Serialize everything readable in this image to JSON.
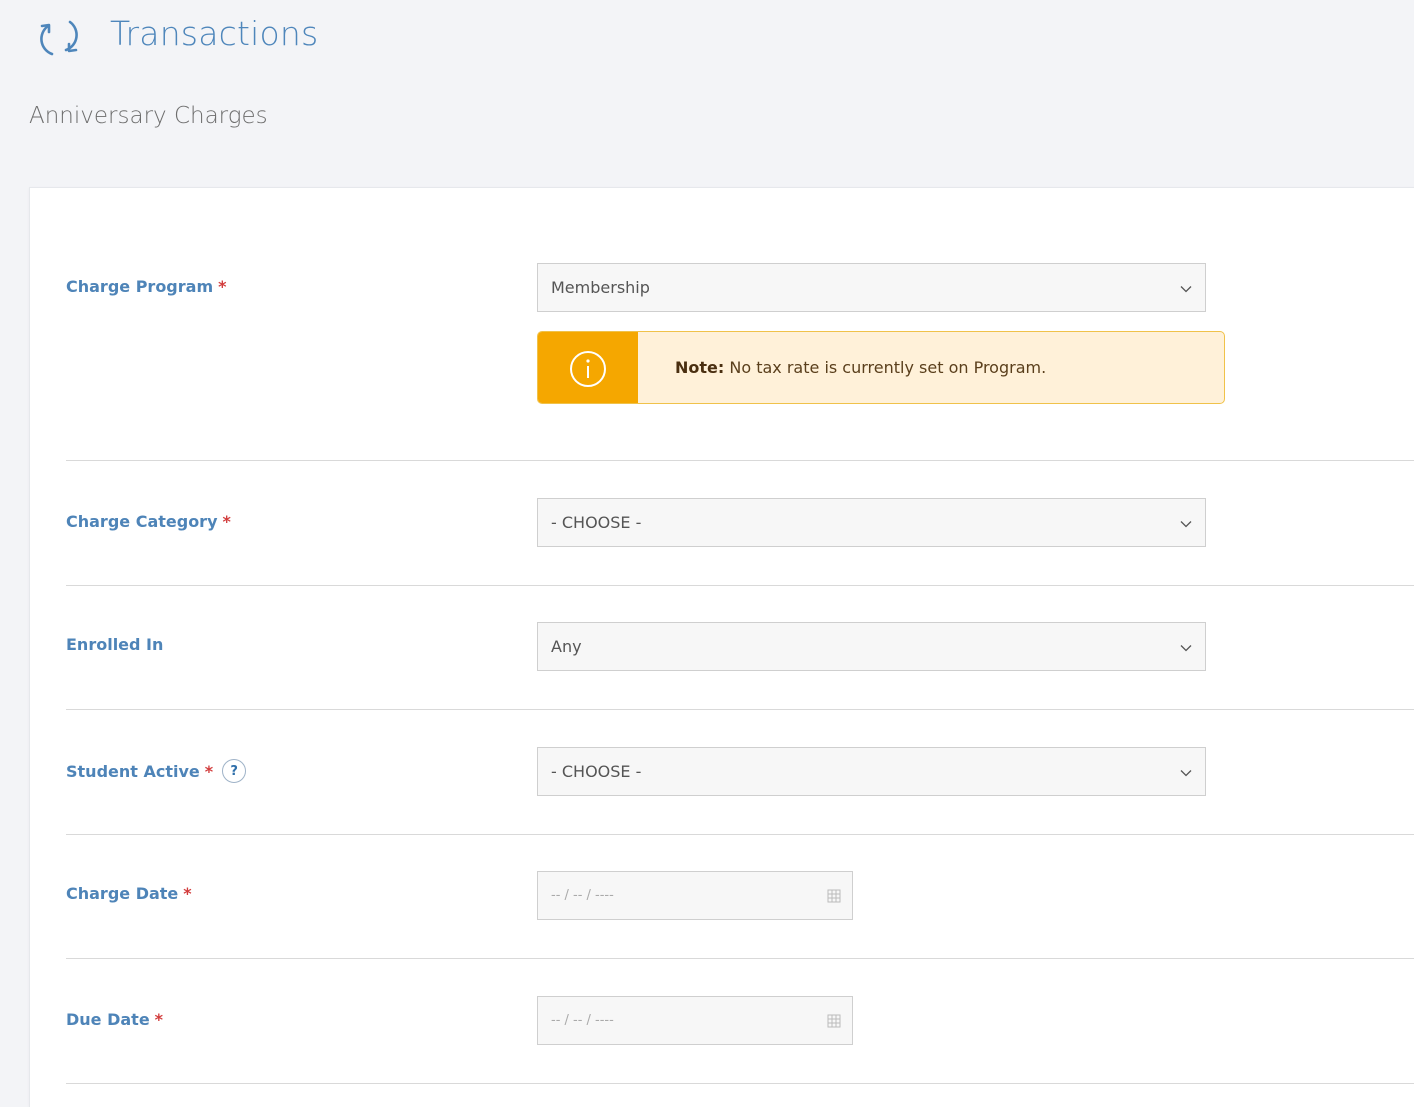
{
  "header": {
    "title": "Transactions",
    "icon": "refresh-icon"
  },
  "page": {
    "subtitle": "Anniversary Charges"
  },
  "form": {
    "charge_program": {
      "label": "Charge Program",
      "required_mark": "*",
      "value": "Membership"
    },
    "note": {
      "prefix": "Note:",
      "text": "No tax rate is currently set on Program.",
      "icon": "info-icon"
    },
    "charge_category": {
      "label": "Charge Category",
      "required_mark": "*",
      "value": "- CHOOSE -"
    },
    "enrolled_in": {
      "label": "Enrolled In",
      "value": "Any"
    },
    "student_active": {
      "label": "Student Active",
      "required_mark": "*",
      "help": "?",
      "value": "- CHOOSE -"
    },
    "charge_date": {
      "label": "Charge Date",
      "required_mark": "*",
      "placeholder": "-- / -- / ----"
    },
    "due_date": {
      "label": "Due Date",
      "required_mark": "*",
      "placeholder": "-- / -- / ----"
    }
  },
  "colors": {
    "accent": "#4e84b8",
    "required": "#d23c3c",
    "warning": "#f5a700",
    "warning_bg": "#fff1d9"
  }
}
